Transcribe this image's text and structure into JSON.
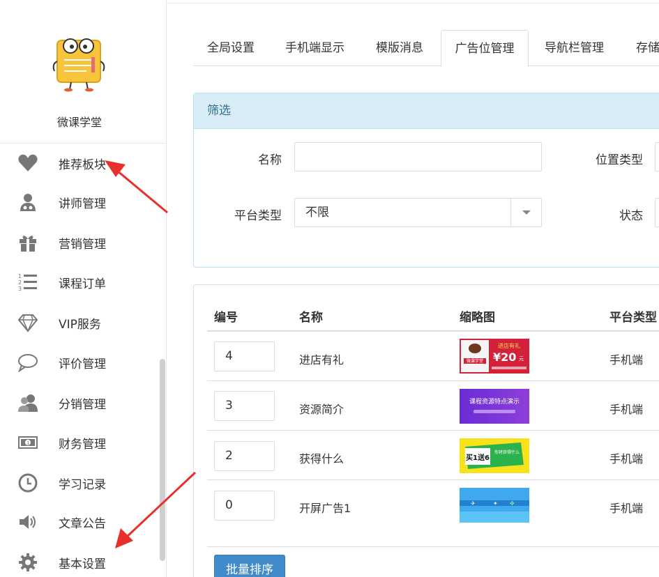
{
  "sidebar": {
    "brand": "微课学堂",
    "items": [
      {
        "label": "推荐板块",
        "icon": "heart-icon"
      },
      {
        "label": "讲师管理",
        "icon": "teacher-icon"
      },
      {
        "label": "营销管理",
        "icon": "gift-icon"
      },
      {
        "label": "课程订单",
        "icon": "ordered-list-icon"
      },
      {
        "label": "VIP服务",
        "icon": "diamond-icon"
      },
      {
        "label": "评价管理",
        "icon": "comment-icon"
      },
      {
        "label": "分销管理",
        "icon": "users-icon"
      },
      {
        "label": "财务管理",
        "icon": "money-icon"
      },
      {
        "label": "学习记录",
        "icon": "clock-icon"
      },
      {
        "label": "文章公告",
        "icon": "volume-icon"
      },
      {
        "label": "基本设置",
        "icon": "gear-icon"
      }
    ]
  },
  "tabs": [
    "全局设置",
    "手机端显示",
    "模版消息",
    "广告位管理",
    "导航栏管理",
    "存储"
  ],
  "filter": {
    "title": "筛选",
    "name_label": "名称",
    "name_value": "",
    "position_type_label": "位置类型",
    "platform_type_label": "平台类型",
    "platform_type_value": "不限",
    "status_label": "状态"
  },
  "table": {
    "headers": [
      "编号",
      "名称",
      "缩略图",
      "平台类型"
    ],
    "rows": [
      {
        "id": "4",
        "name": "进店有礼",
        "platform": "手机端"
      },
      {
        "id": "3",
        "name": "资源简介",
        "platform": "手机端"
      },
      {
        "id": "2",
        "name": "获得什么",
        "platform": "手机端"
      },
      {
        "id": "0",
        "name": "开屏广告1",
        "platform": "手机端"
      }
    ],
    "batch_sort_label": "批量排序"
  },
  "thumbs": {
    "t1_text1": "进店有礼",
    "t1_text2": "¥20",
    "t1_text3": "元",
    "t1_text4": "微课学堂",
    "t2_text": "课程资源特点演示",
    "t3_text": "买1送6",
    "t3_text2": "你将获得什么"
  },
  "colors": {
    "accent": "#428bca",
    "filter_header_bg": "#d9edf7",
    "filter_header_text": "#31708f",
    "annotation_arrow": "#e8302a"
  }
}
